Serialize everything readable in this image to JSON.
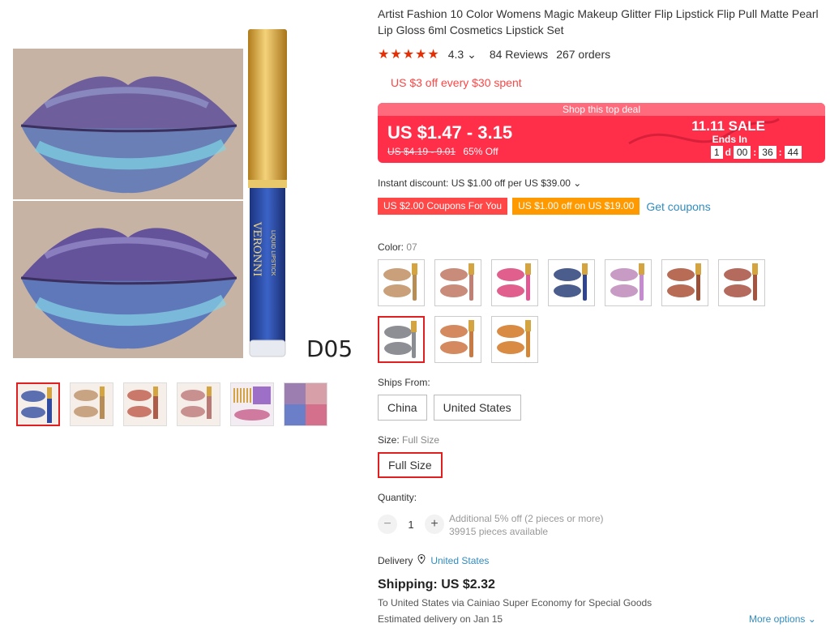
{
  "product": {
    "title": "Artist Fashion 10 Color Womens Magic Makeup Glitter Flip Lipstick Flip Pull Matte Pearl Lip Gloss 6ml Cosmetics Lipstick Set",
    "image_label": "D05",
    "tube_brand": "VERONNI",
    "tube_sub": "LIQUID LIPSTICK"
  },
  "rating": {
    "stars": "★★★★★",
    "score": "4.3",
    "reviews": "84 Reviews",
    "orders": "267 orders",
    "color": "#e62e04"
  },
  "promo": {
    "text": "US $3 off every $30 spent"
  },
  "deal": {
    "banner": "Shop this top deal",
    "price": "US $1.47 - 3.15",
    "old_price": "US $4.19 - 9.01",
    "discount": "65% Off",
    "sale_title": "11.11 SALE",
    "ends_label": "Ends In",
    "timer": {
      "days": "1",
      "d_label": "d",
      "hours": "00",
      "minutes": "36",
      "seconds": "44"
    },
    "bg_color": "#ff2f4a"
  },
  "instant_discount": "Instant discount: US $1.00 off per US $39.00",
  "coupons": {
    "coupon1": "US $2.00 Coupons For You",
    "coupon2": "US $1.00 off on US $19.00",
    "get": "Get coupons"
  },
  "color": {
    "label": "Color:",
    "value": "07",
    "swatches": [
      {
        "lip": "#c9a07a",
        "tube": "#b88c55"
      },
      {
        "lip": "#c98b7a",
        "tube": "#c08073"
      },
      {
        "lip": "#e05f8c",
        "tube": "#e15894"
      },
      {
        "lip": "#4b5d8c",
        "tube": "#30448f"
      },
      {
        "lip": "#c79bc4",
        "tube": "#c58ad0"
      },
      {
        "lip": "#b86b55",
        "tube": "#9b5038"
      },
      {
        "lip": "#b56a5e",
        "tube": "#a5553f"
      },
      {
        "lip": "#8d8f94",
        "tube": "#8a8d92"
      },
      {
        "lip": "#d4895e",
        "tube": "#c87a45"
      },
      {
        "lip": "#d98b43",
        "tube": "#d38838"
      }
    ]
  },
  "ships_from": {
    "label": "Ships From:",
    "options": [
      "China",
      "United States"
    ]
  },
  "size": {
    "label": "Size:",
    "value": "Full Size",
    "option": "Full Size"
  },
  "quantity": {
    "label": "Quantity:",
    "minus": "−",
    "value": "1",
    "plus": "+",
    "additional": "Additional 5% off (2 pieces or more)",
    "available": "39915 pieces available"
  },
  "delivery": {
    "label": "Delivery",
    "location": "United States",
    "shipping": "Shipping: US $2.32",
    "to_line": "To United States via Cainiao Super Economy for Special Goods",
    "estimated": "Estimated delivery on Jan 15",
    "more": "More options"
  }
}
